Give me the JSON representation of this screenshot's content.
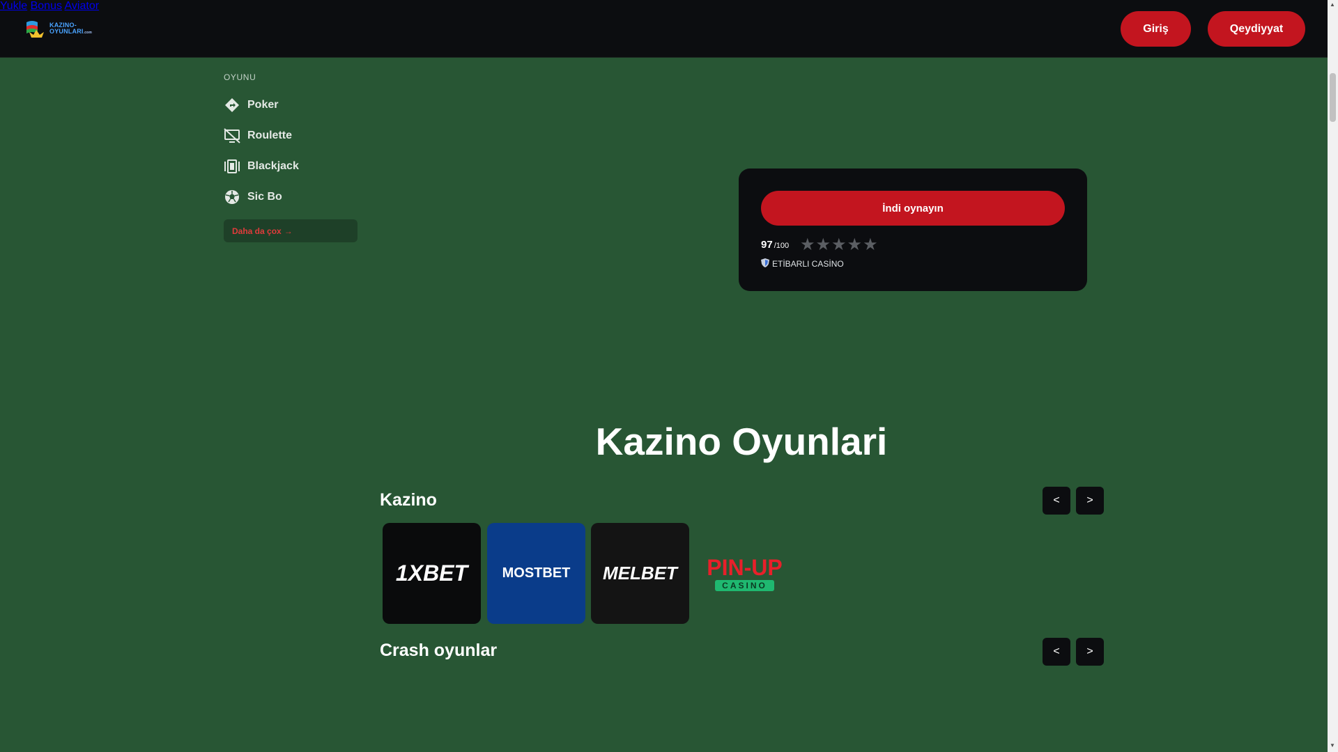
{
  "header": {
    "logo_line1": "KAZINO-",
    "logo_line2": "OYUNLARI",
    "logo_domain": ".com",
    "nav": [
      {
        "label": "Yukle"
      },
      {
        "label": "Bonus"
      },
      {
        "label": "Aviator"
      }
    ],
    "login_label": "Giriş",
    "register_label": "Qeydiyyat"
  },
  "sidebar": {
    "title": "OYUNU",
    "items": [
      {
        "label": "Poker",
        "icon": "poker-icon"
      },
      {
        "label": "Roulette",
        "icon": "roulette-icon"
      },
      {
        "label": "Blackjack",
        "icon": "blackjack-icon"
      },
      {
        "label": "Sic Bo",
        "icon": "sic-bo-icon"
      }
    ],
    "more_label": "Daha da çox"
  },
  "play_card": {
    "button_label": "İndi oynayın",
    "score": "97",
    "score_max": "/100",
    "stars": 5,
    "trusted_label": "ETİBARLI CASİNO"
  },
  "main": {
    "title": "Kazino Oyunlari",
    "sections": [
      {
        "title": "Kazino",
        "prev": "<",
        "next": ">"
      },
      {
        "title": "Crash oyunlar",
        "prev": "<",
        "next": ">"
      }
    ],
    "casino_tiles": [
      {
        "name": "1XBET",
        "bg": "#0a0b0c",
        "color": "#3b8ff0"
      },
      {
        "name": "MOSTBET",
        "bg": "#0a3c8a",
        "color": "#ffffff"
      },
      {
        "name": "MELBET",
        "bg": "#141414",
        "color": "#ffffff"
      },
      {
        "name": "PIN-UP",
        "sub": "CASINO",
        "bg": "transparent",
        "color": "#e8202a"
      }
    ]
  },
  "colors": {
    "page_bg": "#285634",
    "header_bg": "#0c0d10",
    "accent_red": "#c3151f"
  }
}
